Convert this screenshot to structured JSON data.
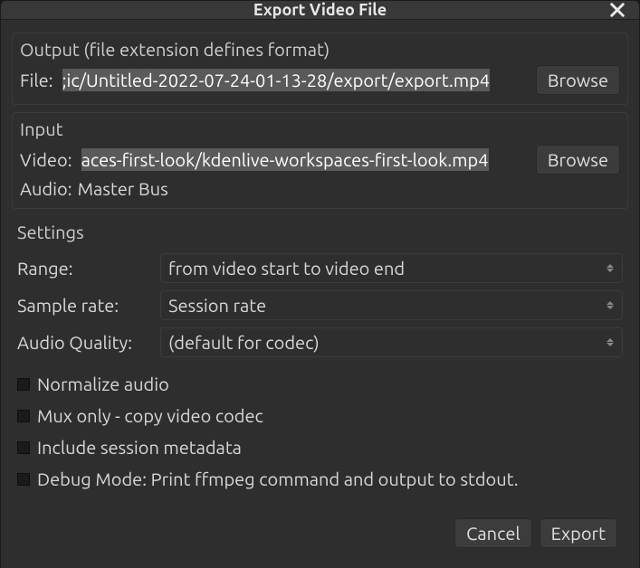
{
  "titlebar": {
    "title": "Export Video File"
  },
  "output": {
    "group_label": "Output (file extension defines format)",
    "file_label": "File:",
    "file_value": ";ic/Untitled-2022-07-24-01-13-28/export/export.mp4",
    "browse_label": "Browse"
  },
  "input": {
    "group_label": "Input",
    "video_label": "Video:",
    "video_value": "aces-first-look/kdenlive-workspaces-first-look.mp4",
    "browse_label": "Browse",
    "audio_label": "Audio:",
    "audio_value": "Master Bus"
  },
  "settings": {
    "group_label": "Settings",
    "range_label": "Range:",
    "range_value": "from video start to video end",
    "sample_rate_label": "Sample rate:",
    "sample_rate_value": "Session rate",
    "audio_quality_label": "Audio Quality:",
    "audio_quality_value": "(default for codec)",
    "normalize_label": "Normalize audio",
    "mux_label": "Mux only - copy video codec",
    "metadata_label": "Include session metadata",
    "debug_label": "Debug Mode: Print ffmpeg command and output to stdout."
  },
  "footer": {
    "cancel_label": "Cancel",
    "export_label": "Export"
  }
}
